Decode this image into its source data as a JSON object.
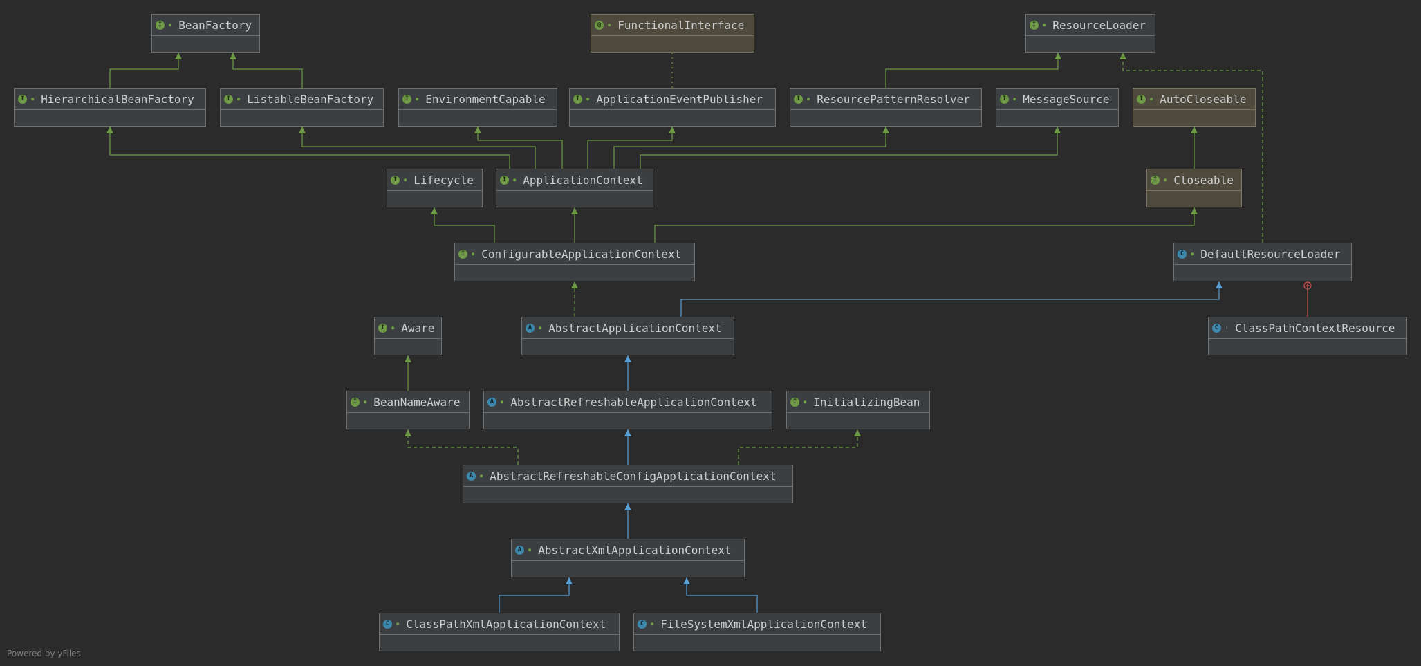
{
  "nodes": [
    {
      "id": "BeanFactory",
      "label": "BeanFactory",
      "kind": "interface"
    },
    {
      "id": "FunctionalInterface",
      "label": "FunctionalInterface",
      "kind": "annotation"
    },
    {
      "id": "ResourceLoader",
      "label": "ResourceLoader",
      "kind": "interface"
    },
    {
      "id": "HierarchicalBeanFactory",
      "label": "HierarchicalBeanFactory",
      "kind": "interface"
    },
    {
      "id": "ListableBeanFactory",
      "label": "ListableBeanFactory",
      "kind": "interface"
    },
    {
      "id": "EnvironmentCapable",
      "label": "EnvironmentCapable",
      "kind": "interface"
    },
    {
      "id": "ApplicationEventPublisher",
      "label": "ApplicationEventPublisher",
      "kind": "interface"
    },
    {
      "id": "ResourcePatternResolver",
      "label": "ResourcePatternResolver",
      "kind": "interface"
    },
    {
      "id": "MessageSource",
      "label": "MessageSource",
      "kind": "interface"
    },
    {
      "id": "AutoCloseable",
      "label": "AutoCloseable",
      "kind": "interface"
    },
    {
      "id": "Lifecycle",
      "label": "Lifecycle",
      "kind": "interface"
    },
    {
      "id": "ApplicationContext",
      "label": "ApplicationContext",
      "kind": "interface"
    },
    {
      "id": "Closeable",
      "label": "Closeable",
      "kind": "interface"
    },
    {
      "id": "ConfigurableApplicationContext",
      "label": "ConfigurableApplicationContext",
      "kind": "interface"
    },
    {
      "id": "DefaultResourceLoader",
      "label": "DefaultResourceLoader",
      "kind": "class"
    },
    {
      "id": "Aware",
      "label": "Aware",
      "kind": "interface"
    },
    {
      "id": "AbstractApplicationContext",
      "label": "AbstractApplicationContext",
      "kind": "abstract"
    },
    {
      "id": "ClassPathContextResource",
      "label": "ClassPathContextResource",
      "kind": "class"
    },
    {
      "id": "BeanNameAware",
      "label": "BeanNameAware",
      "kind": "interface"
    },
    {
      "id": "AbstractRefreshableApplicationContext",
      "label": "AbstractRefreshableApplicationContext",
      "kind": "abstract"
    },
    {
      "id": "InitializingBean",
      "label": "InitializingBean",
      "kind": "interface"
    },
    {
      "id": "AbstractRefreshableConfigApplicationContext",
      "label": "AbstractRefreshableConfigApplicationContext",
      "kind": "abstract"
    },
    {
      "id": "AbstractXmlApplicationContext",
      "label": "AbstractXmlApplicationContext",
      "kind": "abstract"
    },
    {
      "id": "ClassPathXmlApplicationContext",
      "label": "ClassPathXmlApplicationContext",
      "kind": "class"
    },
    {
      "id": "FileSystemXmlApplicationContext",
      "label": "FileSystemXmlApplicationContext",
      "kind": "class"
    }
  ],
  "edges": [
    {
      "from": "HierarchicalBeanFactory",
      "to": "BeanFactory",
      "type": "extends"
    },
    {
      "from": "ListableBeanFactory",
      "to": "BeanFactory",
      "type": "extends"
    },
    {
      "from": "ApplicationEventPublisher",
      "to": "FunctionalInterface",
      "type": "annotated"
    },
    {
      "from": "ResourcePatternResolver",
      "to": "ResourceLoader",
      "type": "extends"
    },
    {
      "from": "DefaultResourceLoader",
      "to": "ResourceLoader",
      "type": "implements"
    },
    {
      "from": "ApplicationContext",
      "to": "HierarchicalBeanFactory",
      "type": "extends"
    },
    {
      "from": "ApplicationContext",
      "to": "ListableBeanFactory",
      "type": "extends"
    },
    {
      "from": "ApplicationContext",
      "to": "EnvironmentCapable",
      "type": "extends"
    },
    {
      "from": "ApplicationContext",
      "to": "ApplicationEventPublisher",
      "type": "extends"
    },
    {
      "from": "ApplicationContext",
      "to": "ResourcePatternResolver",
      "type": "extends"
    },
    {
      "from": "ApplicationContext",
      "to": "MessageSource",
      "type": "extends"
    },
    {
      "from": "Closeable",
      "to": "AutoCloseable",
      "type": "extends"
    },
    {
      "from": "ConfigurableApplicationContext",
      "to": "Lifecycle",
      "type": "extends"
    },
    {
      "from": "ConfigurableApplicationContext",
      "to": "ApplicationContext",
      "type": "extends"
    },
    {
      "from": "ConfigurableApplicationContext",
      "to": "Closeable",
      "type": "extends"
    },
    {
      "from": "AbstractApplicationContext",
      "to": "ConfigurableApplicationContext",
      "type": "implements"
    },
    {
      "from": "AbstractApplicationContext",
      "to": "DefaultResourceLoader",
      "type": "class-extends"
    },
    {
      "from": "ClassPathContextResource",
      "to": "DefaultResourceLoader",
      "type": "inner"
    },
    {
      "from": "BeanNameAware",
      "to": "Aware",
      "type": "extends"
    },
    {
      "from": "AbstractRefreshableApplicationContext",
      "to": "AbstractApplicationContext",
      "type": "class-extends"
    },
    {
      "from": "AbstractRefreshableConfigApplicationContext",
      "to": "AbstractRefreshableApplicationContext",
      "type": "class-extends"
    },
    {
      "from": "AbstractRefreshableConfigApplicationContext",
      "to": "BeanNameAware",
      "type": "implements"
    },
    {
      "from": "AbstractRefreshableConfigApplicationContext",
      "to": "InitializingBean",
      "type": "implements"
    },
    {
      "from": "AbstractXmlApplicationContext",
      "to": "AbstractRefreshableConfigApplicationContext",
      "type": "class-extends"
    },
    {
      "from": "ClassPathXmlApplicationContext",
      "to": "AbstractXmlApplicationContext",
      "type": "class-extends"
    },
    {
      "from": "FileSystemXmlApplicationContext",
      "to": "AbstractXmlApplicationContext",
      "type": "class-extends"
    }
  ],
  "colors": {
    "background": "#2b2b2b",
    "extends": "#6e9a45",
    "class_extends": "#5a9fd4",
    "inner": "#d05050",
    "annotated": "#6e9a45"
  },
  "footer": "Powered by yFiles"
}
